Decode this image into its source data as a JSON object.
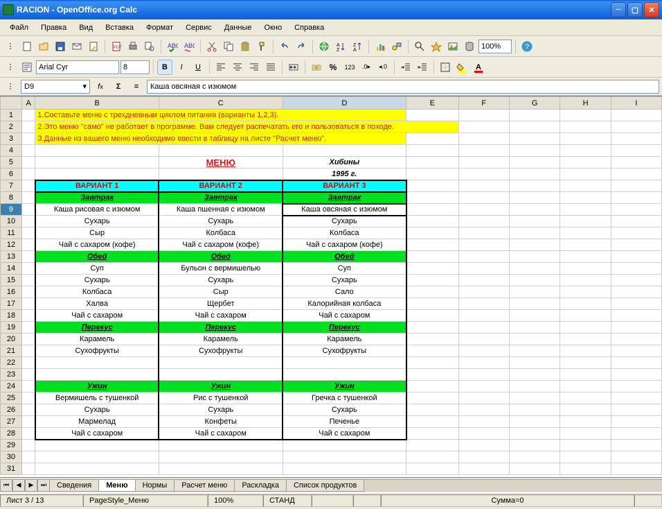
{
  "window": {
    "title": "RACION - OpenOffice.org Calc"
  },
  "menubar": [
    "Файл",
    "Правка",
    "Вид",
    "Вставка",
    "Формат",
    "Сервис",
    "Данные",
    "Окно",
    "Справка"
  ],
  "toolbar1": {
    "zoom": "100%"
  },
  "toolbar2": {
    "font": "Arial Cyr",
    "size": "8"
  },
  "formulabar": {
    "cellref": "D9",
    "content": "Каша овсяная с изюмом"
  },
  "columns": [
    "A",
    "B",
    "C",
    "D",
    "E",
    "F",
    "G",
    "H",
    "I"
  ],
  "yellowNotes": [
    "1.Составьте меню с трехдневным циклом питания (варианты 1,2,3).",
    "2.Это меню \"само\" не работает в программе. Вам следует распечатать его и пользоваться в походе.",
    "3.Данные из вашего меню необходимо ввести в таблицу на листе \"Расчет меню\"."
  ],
  "menuTitle": "МЕНЮ",
  "location": "Хибины",
  "year": "1995 г.",
  "variants": [
    "ВАРИАНТ 1",
    "ВАРИАНТ 2",
    "ВАРИАНТ 3"
  ],
  "meals": {
    "breakfast": {
      "label": "Завтрак",
      "rows": [
        [
          "Каша рисовая с изюмом",
          "Каша пшенная с изюмом",
          "Каша овсяная с изюмом"
        ],
        [
          "Сухарь",
          "Сухарь",
          "Сухарь"
        ],
        [
          "Сыр",
          "Колбаса",
          "Колбаса"
        ],
        [
          "Чай с сахаром (кофе)",
          "Чай с сахаром (кофе)",
          "Чай с сахаром (кофе)"
        ]
      ]
    },
    "lunch": {
      "label": "Обед",
      "rows": [
        [
          "Суп",
          "Бульон с вермишелью",
          "Суп"
        ],
        [
          "Сухарь",
          "Сухарь",
          "Сухарь"
        ],
        [
          "Колбаса",
          "Сыр",
          "Сало"
        ],
        [
          "Халва",
          "Щербет",
          "Калорийная колбаса"
        ],
        [
          "Чай с сахаром",
          "Чай с сахаром",
          "Чай с сахаром"
        ]
      ]
    },
    "snack": {
      "label": "Перекус",
      "rows": [
        [
          "Карамель",
          "Карамель",
          "Карамель"
        ],
        [
          "Сухофрукты",
          "Сухофрукты",
          "Сухофрукты"
        ],
        [
          "",
          "",
          ""
        ],
        [
          "",
          "",
          ""
        ]
      ]
    },
    "dinner": {
      "label": "Ужин",
      "rows": [
        [
          "Вермишель с тушенкой",
          "Рис с тушенкой",
          "Гречка с тушенкой"
        ],
        [
          "Сухарь",
          "Сухарь",
          "Сухарь"
        ],
        [
          "Мармелад",
          "Конфеты",
          "Печенье"
        ],
        [
          "Чай с сахаром",
          "Чай с сахаром",
          "Чай с сахаром"
        ]
      ]
    }
  },
  "tabs": [
    "Сведения",
    "Меню",
    "Нормы",
    "Расчет меню",
    "Раскладка",
    "Список продуктов"
  ],
  "activeTab": 1,
  "statusbar": {
    "sheet": "Лист 3 / 13",
    "pagestyle": "PageStyle_Меню",
    "mode": "СТАНД",
    "sum": "Сумма=0"
  }
}
